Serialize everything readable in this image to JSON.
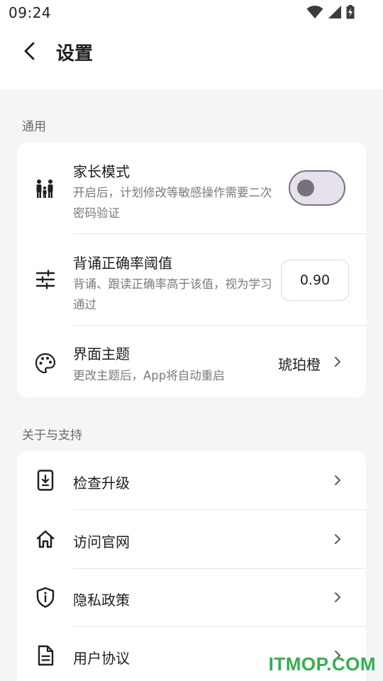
{
  "status_bar": {
    "time": "09:24",
    "icons": [
      "wifi-icon",
      "signal-icon",
      "battery-charging-icon"
    ]
  },
  "app_bar": {
    "back_icon": "back-arrow-icon",
    "title": "设置"
  },
  "sections": {
    "general": {
      "title": "通用",
      "parent_mode": {
        "icon": "family-icon",
        "title": "家长模式",
        "desc": "开启后，计划修改等敏感操作需要二次密码验证",
        "enabled": false
      },
      "threshold": {
        "icon": "sliders-icon",
        "title": "背诵正确率阈值",
        "desc": "背诵、跟读正确率高于该值，视为学习通过",
        "value": "0.90"
      },
      "theme": {
        "icon": "palette-icon",
        "title": "界面主题",
        "desc": "更改主题后，App将自动重启",
        "value": "琥珀橙"
      }
    },
    "about": {
      "title": "关于与支持",
      "items": [
        {
          "icon": "phone-download-icon",
          "label": "检查升级"
        },
        {
          "icon": "home-icon",
          "label": "访问官网"
        },
        {
          "icon": "shield-info-icon",
          "label": "隐私政策"
        },
        {
          "icon": "document-icon",
          "label": "用户协议"
        }
      ]
    }
  },
  "watermark": "ITMOP.COM",
  "colors": {
    "background": "#f4f5f7",
    "card": "#ffffff",
    "toggle_border": "#76727c",
    "toggle_track": "#e6e1ea",
    "watermark": "#2fb24c"
  }
}
